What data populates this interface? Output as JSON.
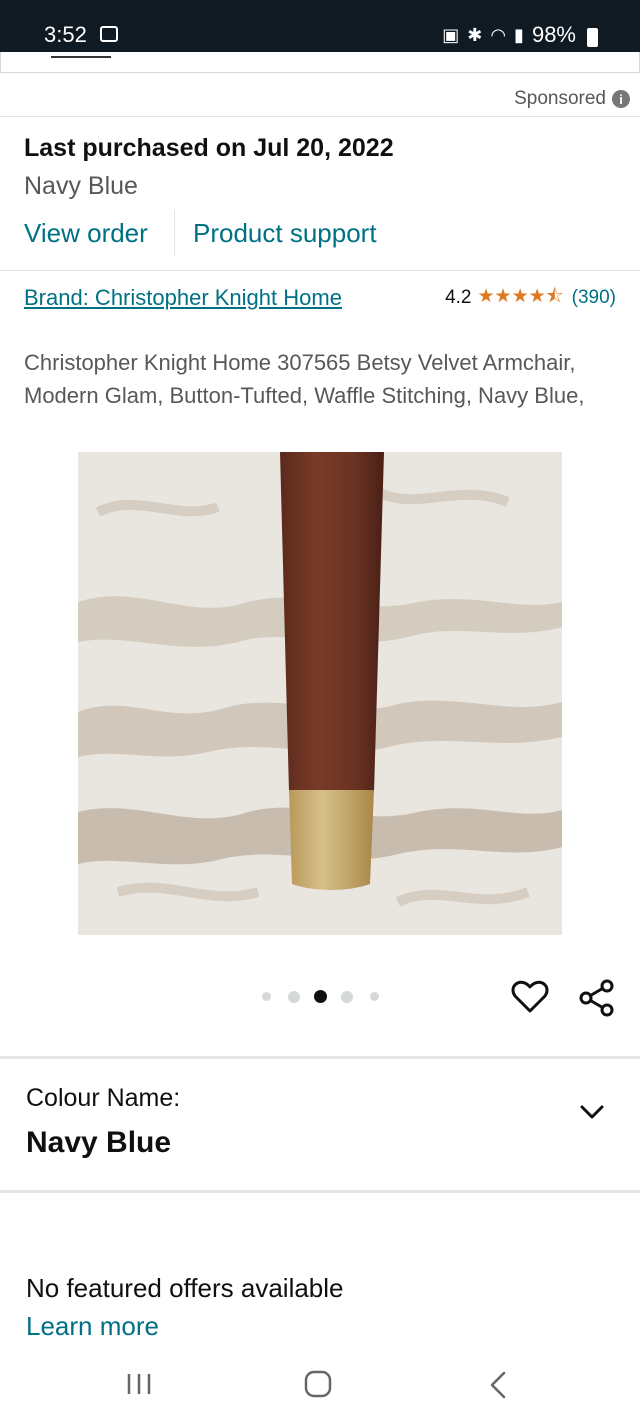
{
  "status_bar": {
    "time": "3:52",
    "battery": "98%",
    "icons": [
      "gallery-icon",
      "battery-saver-icon",
      "bluetooth-icon",
      "wifi-icon",
      "signal-icon",
      "battery-icon"
    ]
  },
  "sponsored": {
    "label": "Sponsored",
    "icon": "info-icon"
  },
  "purchase": {
    "last_purchased": "Last purchased on Jul 20, 2022",
    "variant": "Navy Blue",
    "view_order": "View order",
    "product_support": "Product support"
  },
  "product": {
    "brand": "Brand: Christopher Knight Home",
    "rating_value": "4.2",
    "stars": "★★★★⯪",
    "rating_count": "(390)",
    "title": "Christopher Knight Home 307565 Betsy Velvet Armchair, Modern Glam, Button-Tufted, Waffle Stitching, Navy Blue,",
    "image_alt": "Product image: wooden chair leg with gold cap on patterned rug",
    "carousel_total": 5,
    "carousel_active": 3
  },
  "colour": {
    "label": "Colour Name:",
    "value": "Navy Blue"
  },
  "offers": {
    "message": "No featured offers available",
    "learn_more": "Learn more"
  },
  "colors": {
    "link": "#007185",
    "star": "#de7921",
    "text": "#0f1111",
    "muted": "#565959",
    "status_bar": "#0f1a22"
  }
}
